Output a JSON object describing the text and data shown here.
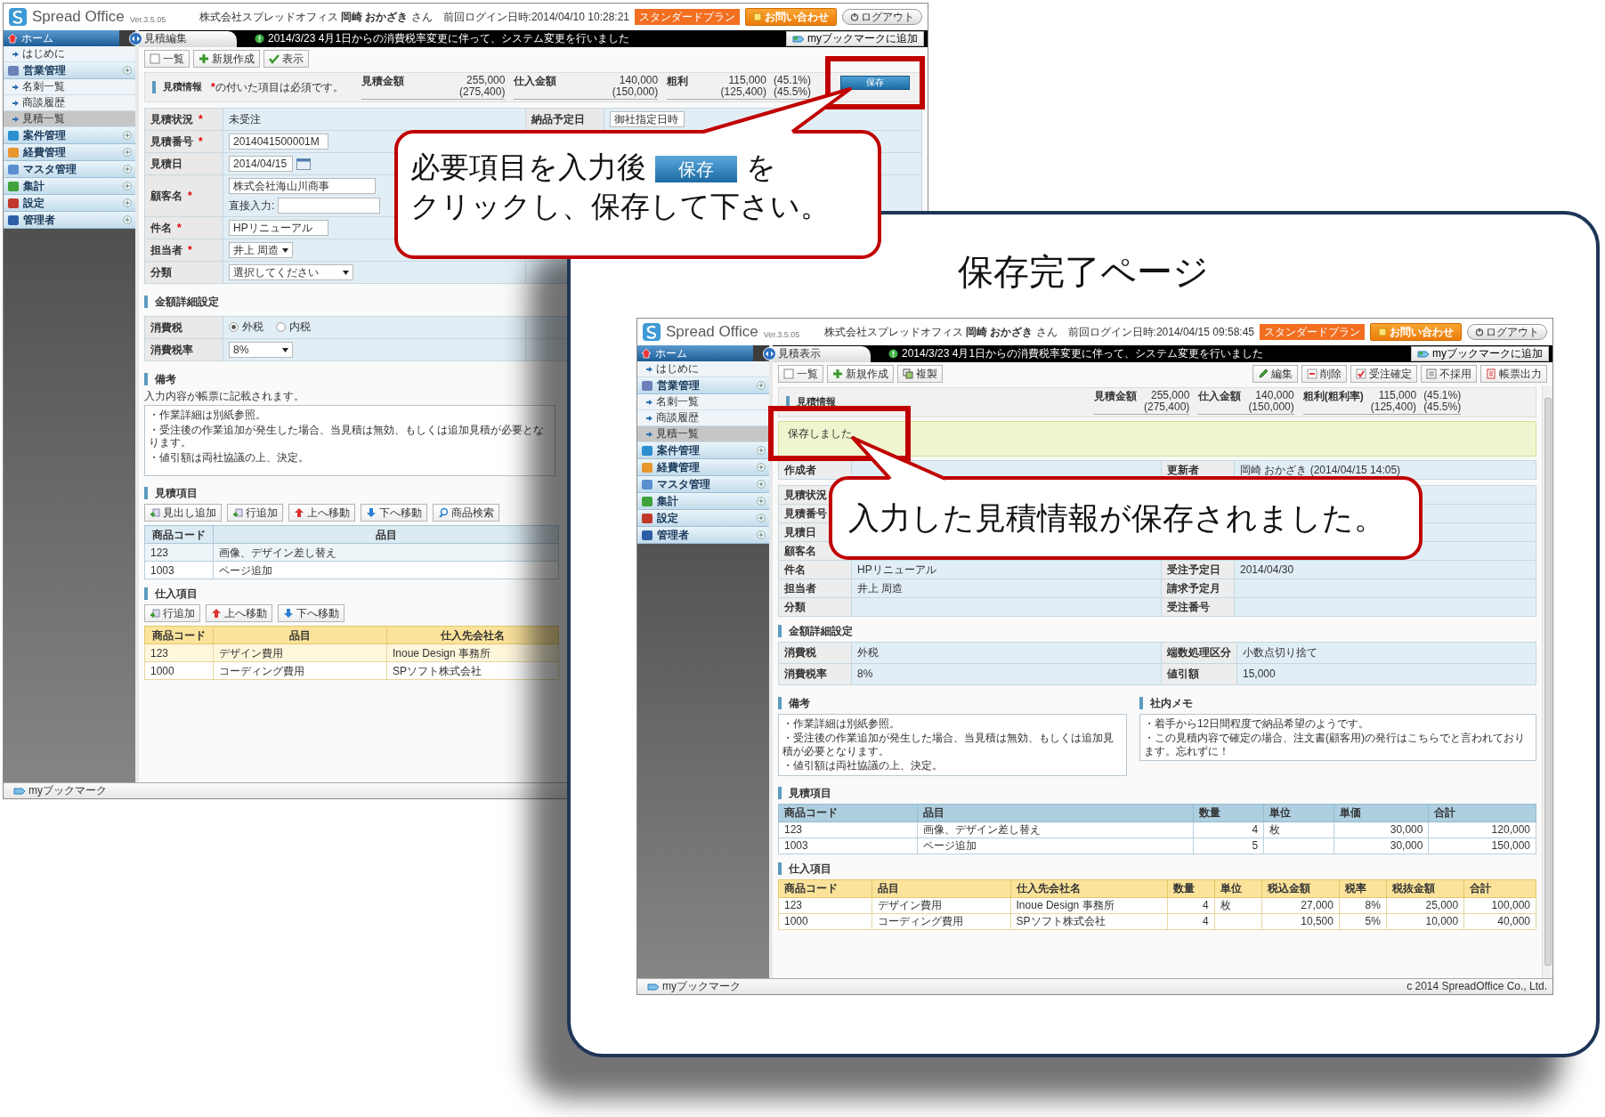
{
  "edit_screen": {
    "header": {
      "logo": "Spread Office",
      "version": "Ver.3.5.05",
      "user_line": "株式会社スプレッドオフィス **岡崎 おかざき** さん　前回ログイン日時:2014/04/10 10:28:21",
      "plan": "スタンダードプラン",
      "contact": "お問い合わせ",
      "logout": "ログアウト"
    },
    "sidebar": {
      "home": "ホーム",
      "items": [
        {
          "label": "はじめに",
          "kind": "link",
          "selected": false
        },
        {
          "label": "営業管理",
          "kind": "section",
          "selected": false
        },
        {
          "label": "名刺一覧",
          "kind": "link",
          "selected": false
        },
        {
          "label": "商談履歴",
          "kind": "link",
          "selected": false
        },
        {
          "label": "見積一覧",
          "kind": "link",
          "selected": true
        },
        {
          "label": "案件管理",
          "kind": "section",
          "selected": false
        },
        {
          "label": "経費管理",
          "kind": "section",
          "selected": false
        },
        {
          "label": "マスタ管理",
          "kind": "section",
          "selected": false
        },
        {
          "label": "集計",
          "kind": "section",
          "selected": false
        },
        {
          "label": "設定",
          "kind": "section",
          "selected": false
        },
        {
          "label": "管理者",
          "kind": "section",
          "selected": false
        }
      ]
    },
    "tab": "見積編集",
    "notice": "2014/3/23 4月1日からの消費税率変更に伴って、システム変更を行いました",
    "bookmark": "myブックマークに追加",
    "toolbar": [
      {
        "label": "一覧",
        "kind": "list"
      },
      {
        "label": "新規作成",
        "kind": "new"
      },
      {
        "label": "表示",
        "kind": "view"
      }
    ],
    "summary": {
      "title": "見積情報",
      "note_mark": "*",
      "note": "の付いた項目は必須です。",
      "save": "保存",
      "metrics": [
        {
          "label": "見積金額",
          "value": "255,000",
          "sub": "(275,400)"
        },
        {
          "label": "仕入金額",
          "value": "140,000",
          "sub": "(150,000)"
        },
        {
          "label": "粗利",
          "value": "115,000",
          "sub": "(125,400)",
          "rate": "(45.1%)",
          "rate_sub": "(45.5%)"
        }
      ]
    },
    "form": [
      {
        "label": "見積状況",
        "mark": "*",
        "kind": "text",
        "value": "未受注",
        "extra": {
          "label": "納品予定日",
          "value": "御社指定日時"
        }
      },
      {
        "label": "見積番号",
        "mark": "*",
        "kind": "input",
        "value": "2014041500001M"
      },
      {
        "label": "見積日",
        "kind": "date",
        "value": "2014/04/15"
      },
      {
        "label": "顧客名",
        "mark": "*",
        "kind": "customer",
        "value": "株式会社海山川商事",
        "direct_label": "直接入力:"
      },
      {
        "label": "件名",
        "mark": "*",
        "kind": "input",
        "value": "HPリニューアル"
      },
      {
        "label": "担当者",
        "mark": "*",
        "kind": "select",
        "value": "井上 周造"
      },
      {
        "label": "分類",
        "kind": "select",
        "value": "選択してください"
      }
    ],
    "tax": {
      "title": "金額詳細設定",
      "rows": [
        {
          "label": "消費税",
          "kind": "radio",
          "options": [
            {
              "label": "外税",
              "selected": true
            },
            {
              "label": "内税",
              "selected": false
            }
          ]
        },
        {
          "label": "消費税率",
          "kind": "select",
          "value": "8%"
        }
      ]
    },
    "remarks": {
      "title": "備考",
      "hint": "入力内容が帳票に記載されます。",
      "lines": [
        "・作業詳細は別紙参照。",
        "・受注後の作業追加が発生した場合、当見積は無効、もしくは追加見積が必要となります。",
        "・値引額は両社協議の上、決定。"
      ]
    },
    "estimate_items": {
      "title": "見積項目",
      "buttons": [
        {
          "label": "見出し追加",
          "kind": "add"
        },
        {
          "label": "行追加",
          "kind": "add"
        },
        {
          "label": "上へ移動",
          "kind": "up"
        },
        {
          "label": "下へ移動",
          "kind": "down"
        },
        {
          "label": "商品検索",
          "kind": "search"
        }
      ],
      "columns": [
        {
          "label": "商品コード",
          "kind": "text"
        },
        {
          "label": "品目",
          "kind": "text"
        }
      ],
      "rows": [
        [
          "123",
          "画像、デザイン差し替え"
        ],
        [
          "1003",
          "ページ追加"
        ]
      ]
    },
    "purchase_items": {
      "title": "仕入項目",
      "buttons": [
        {
          "label": "行追加",
          "kind": "add"
        },
        {
          "label": "上へ移動",
          "kind": "up"
        },
        {
          "label": "下へ移動",
          "kind": "down"
        }
      ],
      "columns": [
        {
          "label": "商品コード",
          "kind": "text"
        },
        {
          "label": "品目",
          "kind": "text"
        },
        {
          "label": "仕入先会社名",
          "kind": "text"
        }
      ],
      "rows": [
        [
          "123",
          "デザイン費用",
          "Inoue Design 事務所"
        ],
        [
          "1000",
          "コーディング費用",
          "SPソフト株式会社"
        ]
      ]
    },
    "footer": {
      "bookmark": "myブックマーク"
    }
  },
  "edit_callout": {
    "line1": "必要項目を入力後",
    "button": "保存",
    "line1_end": "を",
    "line2": "クリックし、保存して下さい。"
  },
  "result_panel": {
    "title": "保存完了ページ"
  },
  "view_screen": {
    "header": {
      "logo": "Spread Office",
      "version": "Ver.3.5.05",
      "user_line": "株式会社スプレッドオフィス **岡崎 おかざき** さん　前回ログイン日時:2014/04/15 09:58:45",
      "plan": "スタンダードプラン",
      "contact": "お問い合わせ",
      "logout": "ログアウト"
    },
    "sidebar": {
      "home": "ホーム",
      "items": [
        {
          "label": "はじめに",
          "kind": "link",
          "selected": false
        },
        {
          "label": "営業管理",
          "kind": "section",
          "selected": false
        },
        {
          "label": "名刺一覧",
          "kind": "link",
          "selected": false
        },
        {
          "label": "商談履歴",
          "kind": "link",
          "selected": false
        },
        {
          "label": "見積一覧",
          "kind": "link",
          "selected": true
        },
        {
          "label": "案件管理",
          "kind": "section",
          "selected": false
        },
        {
          "label": "経費管理",
          "kind": "section",
          "selected": false
        },
        {
          "label": "マスタ管理",
          "kind": "section",
          "selected": false
        },
        {
          "label": "集計",
          "kind": "section",
          "selected": false
        },
        {
          "label": "設定",
          "kind": "section",
          "selected": false
        },
        {
          "label": "管理者",
          "kind": "section",
          "selected": false
        }
      ]
    },
    "tab": "見積表示",
    "notice": "2014/3/23 4月1日からの消費税率変更に伴って、システム変更を行いました",
    "bookmark": "myブックマークに追加",
    "toolbar": [
      {
        "label": "一覧",
        "kind": "list"
      },
      {
        "label": "新規作成",
        "kind": "new"
      },
      {
        "label": "複製",
        "kind": "copy"
      }
    ],
    "toolbar_right": [
      {
        "label": "編集",
        "kind": "edit"
      },
      {
        "label": "削除",
        "kind": "delete"
      },
      {
        "label": "受注確定",
        "kind": "confirm"
      },
      {
        "label": "不採用",
        "kind": "reject"
      },
      {
        "label": "帳票出力",
        "kind": "print"
      }
    ],
    "summary": {
      "title": "見積情報",
      "metrics": [
        {
          "label": "見積金額",
          "value": "255,000",
          "sub": "(275,400)"
        },
        {
          "label": "仕入金額",
          "value": "140,000",
          "sub": "(150,000)"
        },
        {
          "label": "粗利(粗利率)",
          "value": "115,000",
          "sub": "(125,400)",
          "rate": "(45.1%)",
          "rate_sub": "(45.5%)"
        }
      ]
    },
    "message": "保存しました。",
    "creator": {
      "left": {
        "label": "作成者"
      },
      "right": {
        "label": "更新者",
        "value": "岡崎 おかざき (2014/04/15 14:05)"
      }
    },
    "form": [
      {
        "left": {
          "label": "見積状況"
        }
      },
      {
        "left": {
          "label": "見積番号"
        }
      },
      {
        "left": {
          "label": "見積日"
        }
      },
      {
        "left": {
          "label": "顧客名"
        }
      },
      {
        "left": {
          "label": "件名",
          "value": "HPリニューアル"
        },
        "right": {
          "label": "受注予定日",
          "value": "2014/04/30"
        }
      },
      {
        "left": {
          "label": "担当者",
          "value": "井上 周造"
        },
        "right": {
          "label": "請求予定月"
        }
      },
      {
        "left": {
          "label": "分類"
        },
        "right": {
          "label": "受注番号"
        }
      }
    ],
    "tax": {
      "title": "金額詳細設定",
      "rows": [
        {
          "left": {
            "label": "消費税",
            "value": "外税"
          },
          "right": {
            "label": "端数処理区分",
            "value": "小数点切り捨て"
          }
        },
        {
          "left": {
            "label": "消費税率",
            "value": "8%"
          },
          "right": {
            "label": "値引額",
            "value": "15,000"
          }
        }
      ]
    },
    "remarks": {
      "title": "備考",
      "lines": [
        "・作業詳細は別紙参照。",
        "・受注後の作業追加が発生した場合、当見積は無効、もしくは追加見積が必要となります。",
        "・値引額は両社協議の上、決定。"
      ]
    },
    "memo": {
      "title": "社内メモ",
      "lines": [
        "・着手から12日間程度で納品希望のようです。",
        "・この見積内容で確定の場合、注文書(顧客用)の発行はこちらでと言われております。忘れずに！"
      ]
    },
    "estimate_items": {
      "title": "見積項目",
      "columns": [
        {
          "label": "商品コード",
          "kind": "text"
        },
        {
          "label": "品目",
          "kind": "text"
        },
        {
          "label": "数量",
          "kind": "number"
        },
        {
          "label": "単位",
          "kind": "text"
        },
        {
          "label": "単価",
          "kind": "number"
        },
        {
          "label": "合計",
          "kind": "number"
        }
      ],
      "rows": [
        [
          "123",
          "画像、デザイン差し替え",
          "4",
          "枚",
          "30,000",
          "120,000"
        ],
        [
          "1003",
          "ページ追加",
          "5",
          null,
          "30,000",
          "150,000"
        ]
      ]
    },
    "purchase_items": {
      "title": "仕入項目",
      "columns": [
        {
          "label": "商品コード",
          "kind": "text"
        },
        {
          "label": "品目",
          "kind": "text"
        },
        {
          "label": "仕入先会社名",
          "kind": "text"
        },
        {
          "label": "数量",
          "kind": "number"
        },
        {
          "label": "単位",
          "kind": "text"
        },
        {
          "label": "税込金額",
          "kind": "number"
        },
        {
          "label": "税率",
          "kind": "number"
        },
        {
          "label": "税抜金額",
          "kind": "number"
        },
        {
          "label": "合計",
          "kind": "number"
        }
      ],
      "rows": [
        [
          "123",
          "デザイン費用",
          "Inoue Design 事務所",
          "4",
          "枚",
          "27,000",
          "8%",
          "25,000",
          "100,000"
        ],
        [
          "1000",
          "コーディング費用",
          "SPソフト株式会社",
          "4",
          null,
          "10,500",
          "5%",
          "10,000",
          "40,000"
        ]
      ]
    },
    "footer": {
      "bookmark": "myブックマーク",
      "copyright": "c 2014 SpreadOffice Co., Ltd."
    }
  },
  "view_callout": {
    "text": "入力した見積情報が保存されました。"
  }
}
